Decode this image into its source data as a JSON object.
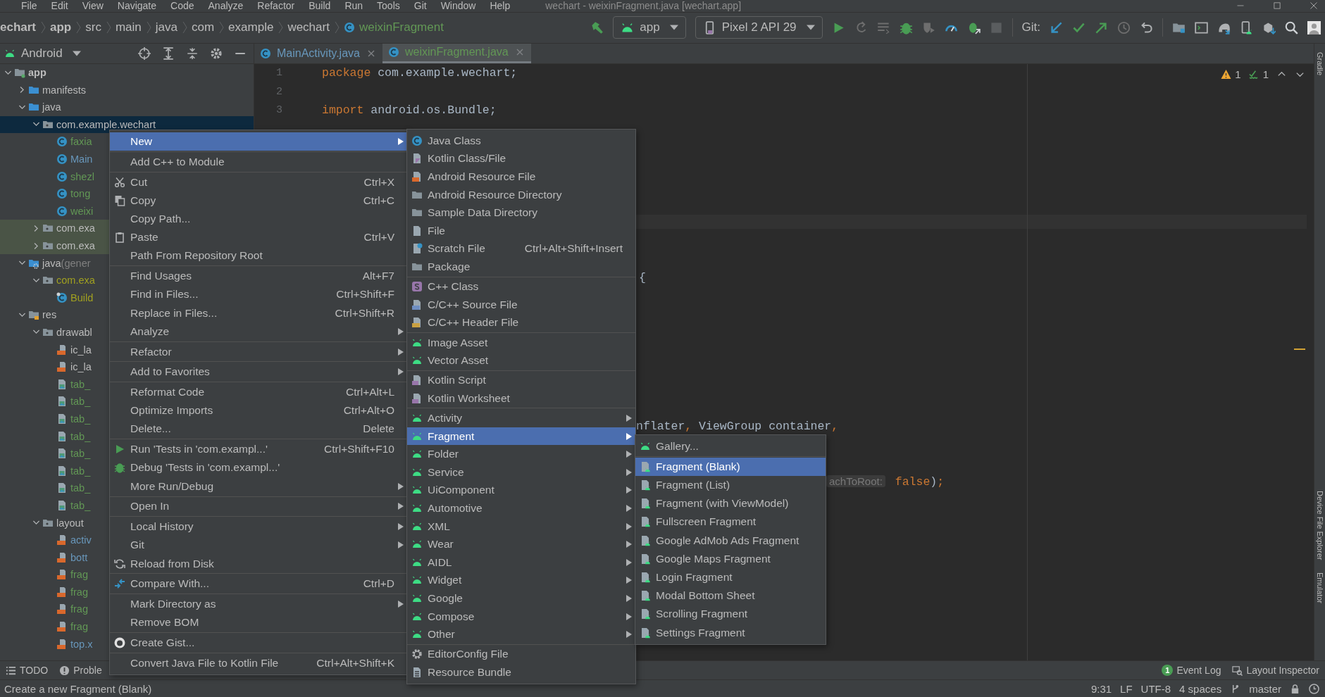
{
  "menu_bar": {
    "items": [
      "File",
      "Edit",
      "View",
      "Navigate",
      "Code",
      "Analyze",
      "Refactor",
      "Build",
      "Run",
      "Tools",
      "Git",
      "Window",
      "Help"
    ],
    "title": "wechart - weixinFragment.java [wechart.app]"
  },
  "breadcrumb": [
    "echart",
    "app",
    "src",
    "main",
    "java",
    "com",
    "example",
    "wechart",
    "weixinFragment"
  ],
  "run_config": "app",
  "device": "Pixel 2 API 29",
  "git_label": "Git:",
  "project_view": "Android",
  "editor_tabs": [
    {
      "label": "MainActivity.java",
      "selected": false
    },
    {
      "label": "weixinFragment.java",
      "selected": true
    }
  ],
  "tree": [
    {
      "label": "app",
      "kind": "module",
      "color": "#bbbbbb",
      "expanded": true,
      "selected": false,
      "highlighted": false,
      "children": [
        {
          "label": "manifests",
          "kind": "source",
          "color": "#bbbbbb",
          "expanded": false,
          "selected": false,
          "highlighted": false
        },
        {
          "label": "java",
          "kind": "source",
          "color": "#bbbbbb",
          "expanded": true,
          "selected": false,
          "highlighted": false,
          "children": [
            {
              "label": "com.example.wechart",
              "kind": "package",
              "color": "#bbbbbb",
              "expanded": true,
              "selected": true,
              "highlighted": false,
              "children": [
                {
                  "label": "faxia",
                  "kind": "class",
                  "color": "#629755",
                  "selected": false,
                  "highlighted": false
                },
                {
                  "label": "Main",
                  "kind": "class",
                  "color": "#6897bb",
                  "selected": false,
                  "highlighted": false
                },
                {
                  "label": "shezl",
                  "kind": "class",
                  "color": "#629755",
                  "selected": false,
                  "highlighted": false
                },
                {
                  "label": "tong",
                  "kind": "class",
                  "color": "#629755",
                  "selected": false,
                  "highlighted": false
                },
                {
                  "label": "weixi",
                  "kind": "class",
                  "color": "#629755",
                  "selected": false,
                  "highlighted": false
                }
              ]
            },
            {
              "label": "com.exa",
              "kind": "package",
              "color": "#bbbbbb",
              "expanded": false,
              "selected": false,
              "highlighted": true
            },
            {
              "label": "com.exa",
              "kind": "package",
              "color": "#bbbbbb",
              "expanded": false,
              "selected": false,
              "highlighted": true
            }
          ]
        },
        {
          "label": "java",
          "hint": "(gener",
          "kind": "generated",
          "color": "#bbbbbb",
          "expanded": true,
          "selected": false,
          "highlighted": false,
          "children": [
            {
              "label": "com.exa",
              "kind": "package",
              "color": "#a0a020",
              "expanded": true,
              "selected": false,
              "highlighted": false,
              "children": [
                {
                  "label": "Build",
                  "kind": "genclass",
                  "color": "#a0a020",
                  "selected": false,
                  "highlighted": false
                }
              ]
            }
          ]
        },
        {
          "label": "res",
          "kind": "res",
          "color": "#bbbbbb",
          "expanded": true,
          "selected": false,
          "highlighted": false,
          "children": [
            {
              "label": "drawabl",
              "kind": "package",
              "color": "#bbbbbb",
              "expanded": true,
              "selected": false,
              "highlighted": false,
              "children": [
                {
                  "label": "ic_la",
                  "kind": "xml",
                  "color": "#bbbbbb",
                  "selected": false,
                  "highlighted": false
                },
                {
                  "label": "ic_la",
                  "kind": "xml",
                  "color": "#bbbbbb",
                  "selected": false,
                  "highlighted": false
                },
                {
                  "label": "tab_",
                  "kind": "image",
                  "color": "#629755",
                  "selected": false,
                  "highlighted": false
                },
                {
                  "label": "tab_",
                  "kind": "image",
                  "color": "#629755",
                  "selected": false,
                  "highlighted": false
                },
                {
                  "label": "tab_",
                  "kind": "image",
                  "color": "#629755",
                  "selected": false,
                  "highlighted": false
                },
                {
                  "label": "tab_",
                  "kind": "image",
                  "color": "#629755",
                  "selected": false,
                  "highlighted": false
                },
                {
                  "label": "tab_",
                  "kind": "image",
                  "color": "#629755",
                  "selected": false,
                  "highlighted": false
                },
                {
                  "label": "tab_",
                  "kind": "image",
                  "color": "#629755",
                  "selected": false,
                  "highlighted": false
                },
                {
                  "label": "tab_",
                  "kind": "image",
                  "color": "#629755",
                  "selected": false,
                  "highlighted": false
                },
                {
                  "label": "tab_",
                  "kind": "image",
                  "color": "#629755",
                  "selected": false,
                  "highlighted": false
                }
              ]
            },
            {
              "label": "layout",
              "kind": "package",
              "color": "#bbbbbb",
              "expanded": true,
              "selected": false,
              "highlighted": false,
              "children": [
                {
                  "label": "activ",
                  "kind": "xml",
                  "color": "#6897bb",
                  "selected": false,
                  "highlighted": false
                },
                {
                  "label": "bott",
                  "kind": "xml",
                  "color": "#6897bb",
                  "selected": false,
                  "highlighted": false
                },
                {
                  "label": "frag",
                  "kind": "xml",
                  "color": "#629755",
                  "selected": false,
                  "highlighted": false
                },
                {
                  "label": "frag",
                  "kind": "xml",
                  "color": "#629755",
                  "selected": false,
                  "highlighted": false
                },
                {
                  "label": "frag",
                  "kind": "xml",
                  "color": "#629755",
                  "selected": false,
                  "highlighted": false
                },
                {
                  "label": "frag",
                  "kind": "xml",
                  "color": "#629755",
                  "selected": false,
                  "highlighted": false
                },
                {
                  "label": "top.x",
                  "kind": "xml",
                  "color": "#6897bb",
                  "selected": false,
                  "highlighted": false
                }
              ]
            }
          ]
        }
      ]
    }
  ],
  "code_lines": [
    {
      "number": "1",
      "tokens": [
        {
          "kind": "keyword",
          "text": "package"
        },
        {
          "kind": "plain",
          "text": " com.example.wechart;"
        }
      ]
    },
    {
      "number": "2"
    },
    {
      "number": "3",
      "tokens": [
        {
          "kind": "keyword",
          "text": "import"
        },
        {
          "kind": "plain",
          "text": " android.os.Bundle;"
        }
      ]
    }
  ],
  "code_fragments": [
    {
      "tokens": [
        {
          "kind": "plain",
          "text": "{"
        }
      ]
    },
    {
      "tokens": [
        {
          "kind": "plain",
          "text": "nflater"
        },
        {
          "kind": "keyword",
          "text": ","
        },
        {
          "kind": "plain",
          "text": " ViewGroup container"
        },
        {
          "kind": "keyword",
          "text": ","
        }
      ]
    },
    {
      "tokens": [
        {
          "kind": "hint",
          "text": "achToRoot:"
        },
        {
          "kind": "keyword",
          "text": " false"
        },
        {
          "kind": "plain",
          "text": ")"
        },
        {
          "kind": "keyword",
          "text": ";"
        }
      ]
    }
  ],
  "inspections": {
    "warnings": "1",
    "passed": "1"
  },
  "side_tools": [
    "Gradle",
    "Device File Explorer",
    "Emulator"
  ],
  "bottom_tools": [
    "TODO",
    "Proble"
  ],
  "event_log": {
    "label": "Event Log",
    "badge": "1"
  },
  "layout_inspector": "Layout Inspector",
  "status": {
    "message": "Create a new Fragment (Blank)",
    "position": "9:31",
    "line_ending": "LF",
    "encoding": "UTF-8",
    "indent": "4 spaces",
    "branch": "master"
  },
  "context_menu": [
    {
      "kind": "plain",
      "label": "New",
      "submenu": true,
      "selected": true
    },
    {
      "kind": "separator"
    },
    {
      "kind": "plain",
      "label": "Add C++ to Module",
      "submenu": false,
      "selected": false
    },
    {
      "kind": "separator"
    },
    {
      "kind": "scissors",
      "label": "Cut",
      "shortcut": "Ctrl+X",
      "submenu": false,
      "selected": false
    },
    {
      "kind": "copy",
      "label": "Copy",
      "shortcut": "Ctrl+C",
      "submenu": false,
      "selected": false
    },
    {
      "kind": "plain",
      "label": "Copy Path...",
      "submenu": false,
      "selected": false
    },
    {
      "kind": "paste",
      "label": "Paste",
      "shortcut": "Ctrl+V",
      "submenu": false,
      "selected": false
    },
    {
      "kind": "plain",
      "label": "Path From Repository Root",
      "submenu": false,
      "selected": false
    },
    {
      "kind": "separator"
    },
    {
      "kind": "plain",
      "label": "Find Usages",
      "shortcut": "Alt+F7",
      "submenu": false,
      "selected": false
    },
    {
      "kind": "plain",
      "label": "Find in Files...",
      "shortcut": "Ctrl+Shift+F",
      "submenu": false,
      "selected": false
    },
    {
      "kind": "plain",
      "label": "Replace in Files...",
      "shortcut": "Ctrl+Shift+R",
      "submenu": false,
      "selected": false
    },
    {
      "kind": "plain",
      "label": "Analyze",
      "submenu": true,
      "selected": false
    },
    {
      "kind": "separator"
    },
    {
      "kind": "plain",
      "label": "Refactor",
      "submenu": true,
      "selected": false
    },
    {
      "kind": "separator"
    },
    {
      "kind": "plain",
      "label": "Add to Favorites",
      "submenu": true,
      "selected": false
    },
    {
      "kind": "separator"
    },
    {
      "kind": "plain",
      "label": "Reformat Code",
      "shortcut": "Ctrl+Alt+L",
      "submenu": false,
      "selected": false
    },
    {
      "kind": "plain",
      "label": "Optimize Imports",
      "shortcut": "Ctrl+Alt+O",
      "submenu": false,
      "selected": false
    },
    {
      "kind": "plain",
      "label": "Delete...",
      "shortcut": "Delete",
      "submenu": false,
      "selected": false
    },
    {
      "kind": "separator"
    },
    {
      "kind": "run",
      "label": "Run 'Tests in 'com.exampl...'",
      "shortcut": "Ctrl+Shift+F10",
      "submenu": false,
      "selected": false
    },
    {
      "kind": "debug",
      "label": "Debug 'Tests in 'com.exampl...'",
      "submenu": false,
      "selected": false
    },
    {
      "kind": "plain",
      "label": "More Run/Debug",
      "submenu": true,
      "selected": false
    },
    {
      "kind": "separator"
    },
    {
      "kind": "plain",
      "label": "Open In",
      "submenu": true,
      "selected": false
    },
    {
      "kind": "separator"
    },
    {
      "kind": "plain",
      "label": "Local History",
      "submenu": true,
      "selected": false
    },
    {
      "kind": "plain",
      "label": "Git",
      "submenu": true,
      "selected": false
    },
    {
      "kind": "reload",
      "label": "Reload from Disk",
      "submenu": false,
      "selected": false
    },
    {
      "kind": "separator"
    },
    {
      "kind": "compare",
      "label": "Compare With...",
      "shortcut": "Ctrl+D",
      "submenu": false,
      "selected": false
    },
    {
      "kind": "separator"
    },
    {
      "kind": "plain",
      "label": "Mark Directory as",
      "submenu": true,
      "selected": false
    },
    {
      "kind": "plain",
      "label": "Remove BOM",
      "submenu": false,
      "selected": false
    },
    {
      "kind": "separator"
    },
    {
      "kind": "github",
      "label": "Create Gist...",
      "submenu": false,
      "selected": false
    },
    {
      "kind": "separator"
    },
    {
      "kind": "plain",
      "label": "Convert Java File to Kotlin File",
      "shortcut": "Ctrl+Alt+Shift+K",
      "submenu": false,
      "selected": false
    }
  ],
  "new_submenu": [
    {
      "kind": "classfile",
      "label": "Java Class",
      "submenu": false,
      "selected": false
    },
    {
      "kind": "kotlin",
      "label": "Kotlin Class/File",
      "submenu": false,
      "selected": false
    },
    {
      "kind": "resource",
      "label": "Android Resource File",
      "submenu": false,
      "selected": false
    },
    {
      "kind": "folder",
      "label": "Android Resource Directory",
      "submenu": false,
      "selected": false
    },
    {
      "kind": "folder",
      "label": "Sample Data Directory",
      "submenu": false,
      "selected": false
    },
    {
      "kind": "file",
      "label": "File",
      "submenu": false,
      "selected": false
    },
    {
      "kind": "scratch",
      "label": "Scratch File",
      "shortcut": "Ctrl+Alt+Shift+Insert",
      "submenu": false,
      "selected": false
    },
    {
      "kind": "folder",
      "label": "Package",
      "submenu": false,
      "selected": false
    },
    {
      "kind": "separator"
    },
    {
      "kind": "cpp",
      "label": "C++ Class",
      "submenu": false,
      "selected": false
    },
    {
      "kind": "csource",
      "label": "C/C++ Source File",
      "submenu": false,
      "selected": false
    },
    {
      "kind": "cheader",
      "label": "C/C++ Header File",
      "submenu": false,
      "selected": false
    },
    {
      "kind": "separator"
    },
    {
      "kind": "android",
      "label": "Image Asset",
      "submenu": false,
      "selected": false
    },
    {
      "kind": "android",
      "label": "Vector Asset",
      "submenu": false,
      "selected": false
    },
    {
      "kind": "separator"
    },
    {
      "kind": "script",
      "label": "Kotlin Script",
      "submenu": false,
      "selected": false
    },
    {
      "kind": "script",
      "label": "Kotlin Worksheet",
      "submenu": false,
      "selected": false
    },
    {
      "kind": "separator"
    },
    {
      "kind": "android",
      "label": "Activity",
      "submenu": true,
      "selected": false
    },
    {
      "kind": "android",
      "label": "Fragment",
      "submenu": true,
      "selected": true
    },
    {
      "kind": "android",
      "label": "Folder",
      "submenu": true,
      "selected": false
    },
    {
      "kind": "android",
      "label": "Service",
      "submenu": true,
      "selected": false
    },
    {
      "kind": "android",
      "label": "UiComponent",
      "submenu": true,
      "selected": false
    },
    {
      "kind": "android",
      "label": "Automotive",
      "submenu": true,
      "selected": false
    },
    {
      "kind": "android",
      "label": "XML",
      "submenu": true,
      "selected": false
    },
    {
      "kind": "android",
      "label": "Wear",
      "submenu": true,
      "selected": false
    },
    {
      "kind": "android",
      "label": "AIDL",
      "submenu": true,
      "selected": false
    },
    {
      "kind": "android",
      "label": "Widget",
      "submenu": true,
      "selected": false
    },
    {
      "kind": "android",
      "label": "Google",
      "submenu": true,
      "selected": false
    },
    {
      "kind": "android",
      "label": "Compose",
      "submenu": true,
      "selected": false
    },
    {
      "kind": "android",
      "label": "Other",
      "submenu": true,
      "selected": false
    },
    {
      "kind": "separator"
    },
    {
      "kind": "gear",
      "label": "EditorConfig File",
      "submenu": false,
      "selected": false
    },
    {
      "kind": "bundle",
      "label": "Resource Bundle",
      "submenu": false,
      "selected": false
    }
  ],
  "fragment_submenu": [
    {
      "kind": "android",
      "label": "Gallery...",
      "submenu": false,
      "selected": false
    },
    {
      "kind": "separator"
    },
    {
      "kind": "template",
      "label": "Fragment (Blank)",
      "submenu": false,
      "selected": true
    },
    {
      "kind": "template",
      "label": "Fragment (List)",
      "submenu": false,
      "selected": false
    },
    {
      "kind": "template",
      "label": "Fragment (with ViewModel)",
      "submenu": false,
      "selected": false
    },
    {
      "kind": "template",
      "label": "Fullscreen Fragment",
      "submenu": false,
      "selected": false
    },
    {
      "kind": "template",
      "label": "Google AdMob Ads Fragment",
      "submenu": false,
      "selected": false
    },
    {
      "kind": "template",
      "label": "Google Maps Fragment",
      "submenu": false,
      "selected": false
    },
    {
      "kind": "template",
      "label": "Login Fragment",
      "submenu": false,
      "selected": false
    },
    {
      "kind": "template",
      "label": "Modal Bottom Sheet",
      "submenu": false,
      "selected": false
    },
    {
      "kind": "template",
      "label": "Scrolling Fragment",
      "submenu": false,
      "selected": false
    },
    {
      "kind": "template",
      "label": "Settings Fragment",
      "submenu": false,
      "selected": false
    }
  ]
}
